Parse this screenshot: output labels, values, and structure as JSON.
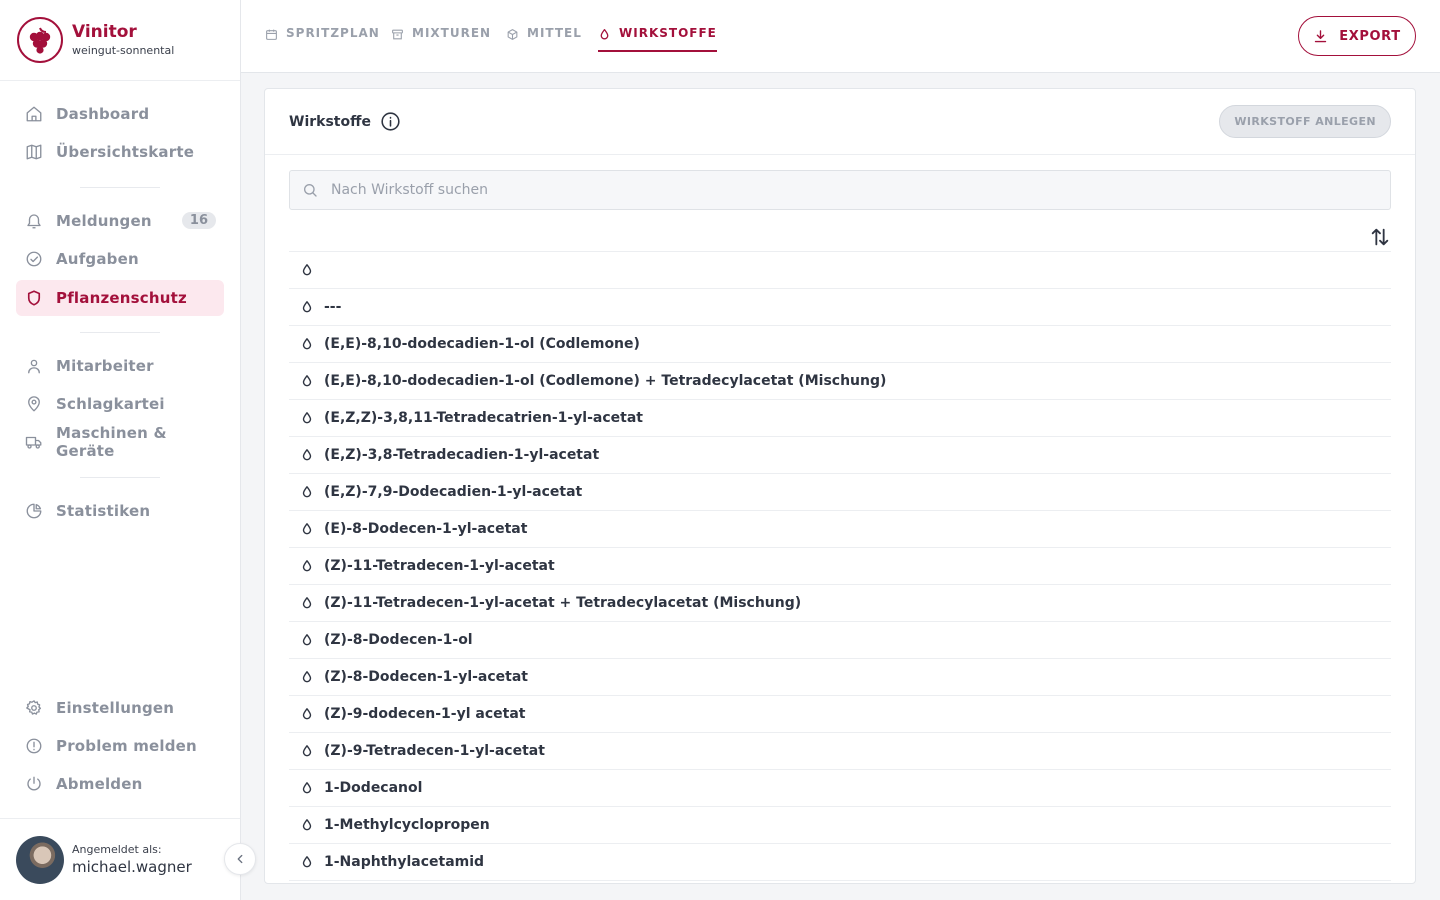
{
  "app": {
    "name": "Vinitor",
    "tenant": "weingut-sonnental",
    "brand_color": "#a3103b"
  },
  "sidebar": {
    "group1": [
      {
        "label": "Dashboard",
        "icon": "home-icon"
      },
      {
        "label": "Übersichtskarte",
        "icon": "map-icon"
      }
    ],
    "group2": [
      {
        "label": "Meldungen",
        "icon": "bell-icon",
        "badge": "16"
      },
      {
        "label": "Aufgaben",
        "icon": "check-circle-icon"
      },
      {
        "label": "Pflanzenschutz",
        "icon": "shield-icon",
        "active": true
      }
    ],
    "group3": [
      {
        "label": "Mitarbeiter",
        "icon": "user-icon"
      },
      {
        "label": "Schlagkartei",
        "icon": "location-pin-icon"
      },
      {
        "label": "Maschinen & Geräte",
        "icon": "truck-icon"
      }
    ],
    "group4": [
      {
        "label": "Statistiken",
        "icon": "pie-chart-icon"
      }
    ],
    "bottom": [
      {
        "label": "Einstellungen",
        "icon": "gear-icon"
      },
      {
        "label": "Problem melden",
        "icon": "alert-circle-icon"
      },
      {
        "label": "Abmelden",
        "icon": "power-icon"
      }
    ]
  },
  "user": {
    "caption": "Angemeldet als:",
    "name": "michael.wagner"
  },
  "tabs": [
    {
      "label": "SPRITZPLAN",
      "icon": "calendar-icon"
    },
    {
      "label": "MIXTUREN",
      "icon": "archive-icon"
    },
    {
      "label": "MITTEL",
      "icon": "box-icon"
    },
    {
      "label": "WIRKSTOFFE",
      "icon": "droplet-icon",
      "active": true
    }
  ],
  "header": {
    "export_label": "EXPORT"
  },
  "card": {
    "title": "Wirkstoffe",
    "add_label": "WIRKSTOFF ANLEGEN",
    "search_placeholder": "Nach Wirkstoff suchen"
  },
  "wirkstoffe": [
    "",
    "---",
    "(E,E)-8,10-dodecadien-1-ol (Codlemone)",
    "(E,E)-8,10-dodecadien-1-ol (Codlemone) + Tetradecylacetat (Mischung)",
    "(E,Z,Z)-3,8,11-Tetradecatrien-1-yl-acetat",
    "(E,Z)-3,8-Tetradecadien-1-yl-acetat",
    "(E,Z)-7,9-Dodecadien-1-yl-acetat",
    "(E)-8-Dodecen-1-yl-acetat",
    "(Z)-11-Tetradecen-1-yl-acetat",
    "(Z)-11-Tetradecen-1-yl-acetat + Tetradecylacetat (Mischung)",
    "(Z)-8-Dodecen-1-ol",
    "(Z)-8-Dodecen-1-yl-acetat",
    "(Z)-9-dodecen-1-yl acetat",
    "(Z)-9-Tetradecen-1-yl-acetat",
    "1-Dodecanol",
    "1-Methylcyclopropen",
    "1-Naphthylacetamid"
  ]
}
